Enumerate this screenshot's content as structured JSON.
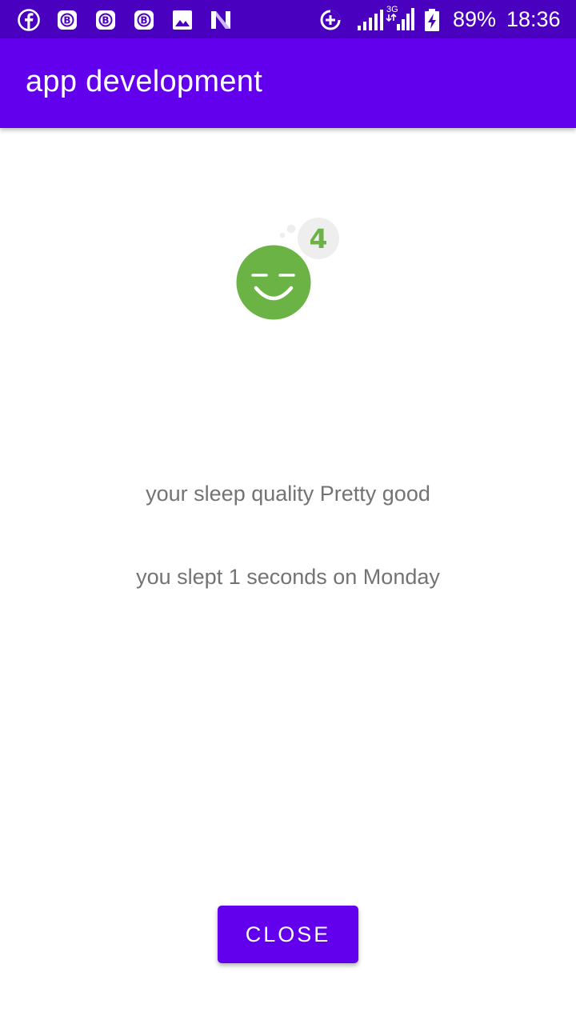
{
  "status_bar": {
    "battery_percent": "89%",
    "time": "18:36",
    "network_type": "3G",
    "left_icons": [
      "facebook-icon",
      "notification-app-icon",
      "notification-app-icon",
      "notification-app-icon",
      "image-icon",
      "n-icon"
    ],
    "right_icons": [
      "data-saver-icon",
      "signal-icon",
      "signal-3g-icon",
      "battery-charging-icon"
    ]
  },
  "app_bar": {
    "title": "app development"
  },
  "sleep": {
    "quality_score": "4",
    "icon": "sleeping-face-icon",
    "quality_text": "your sleep quality Pretty good",
    "duration_text": "you slept 1 seconds on Monday"
  },
  "actions": {
    "close_label": "CLOSE"
  },
  "colors": {
    "status_bar": "#4a00bf",
    "app_bar": "#6200ee",
    "face": "#6ab344",
    "badge_bg": "#eeeeee",
    "text_secondary": "#737373"
  }
}
